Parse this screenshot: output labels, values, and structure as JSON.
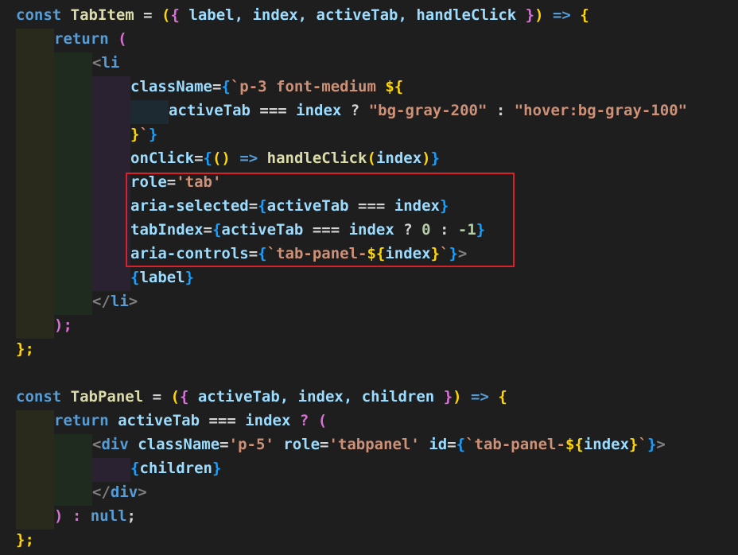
{
  "editor": {
    "theme_background": "#1e1e1e",
    "highlight_color": "#d6222c",
    "lines": [
      [
        "const ",
        "TabItem",
        " = ",
        "(",
        "{",
        " label, index, activeTab, handleClick ",
        "}",
        ")",
        " => ",
        "{"
      ],
      [
        "return",
        " ("
      ],
      [
        "<",
        "li"
      ],
      [
        "className",
        "=",
        "{",
        "`p-3 font-medium ",
        "${"
      ],
      [
        "activeTab",
        " === ",
        "index",
        " ? ",
        "\"bg-gray-200\"",
        " : ",
        "\"hover:bg-gray-100\""
      ],
      [
        "}",
        "`",
        "}"
      ],
      [
        "onClick",
        "=",
        "{",
        "()",
        " => ",
        "handleClick",
        "(",
        "index",
        ")",
        "}"
      ],
      [
        "role",
        "=",
        "'tab'"
      ],
      [
        "aria-selected",
        "=",
        "{",
        "activeTab",
        " === ",
        "index",
        "}"
      ],
      [
        "tabIndex",
        "=",
        "{",
        "activeTab",
        " === ",
        "index",
        " ? ",
        "0",
        " : ",
        "-1",
        "}"
      ],
      [
        "aria-controls",
        "=",
        "{",
        "`tab-panel-",
        "${",
        "index",
        "}",
        "`",
        "}",
        ">"
      ],
      [
        "{",
        "label",
        "}"
      ],
      [
        "</",
        "li",
        ">"
      ],
      [
        ");"
      ],
      [
        "};"
      ],
      [
        "const ",
        "TabPanel",
        " = ",
        "(",
        "{",
        " activeTab, index, children ",
        "}",
        ")",
        " => ",
        "{"
      ],
      [
        "return ",
        "activeTab",
        " === ",
        "index",
        " ? ("
      ],
      [
        "<",
        "div",
        " className",
        "=",
        "'p-5'",
        " role",
        "=",
        "'tabpanel'",
        " id",
        "=",
        "{",
        "`tab-panel-",
        "${",
        "index",
        "}",
        "`",
        "}",
        ">"
      ],
      [
        "{",
        "children",
        "}"
      ],
      [
        "</",
        "div",
        ">"
      ],
      [
        ") : ",
        "null",
        ";"
      ],
      [
        "};"
      ]
    ]
  }
}
